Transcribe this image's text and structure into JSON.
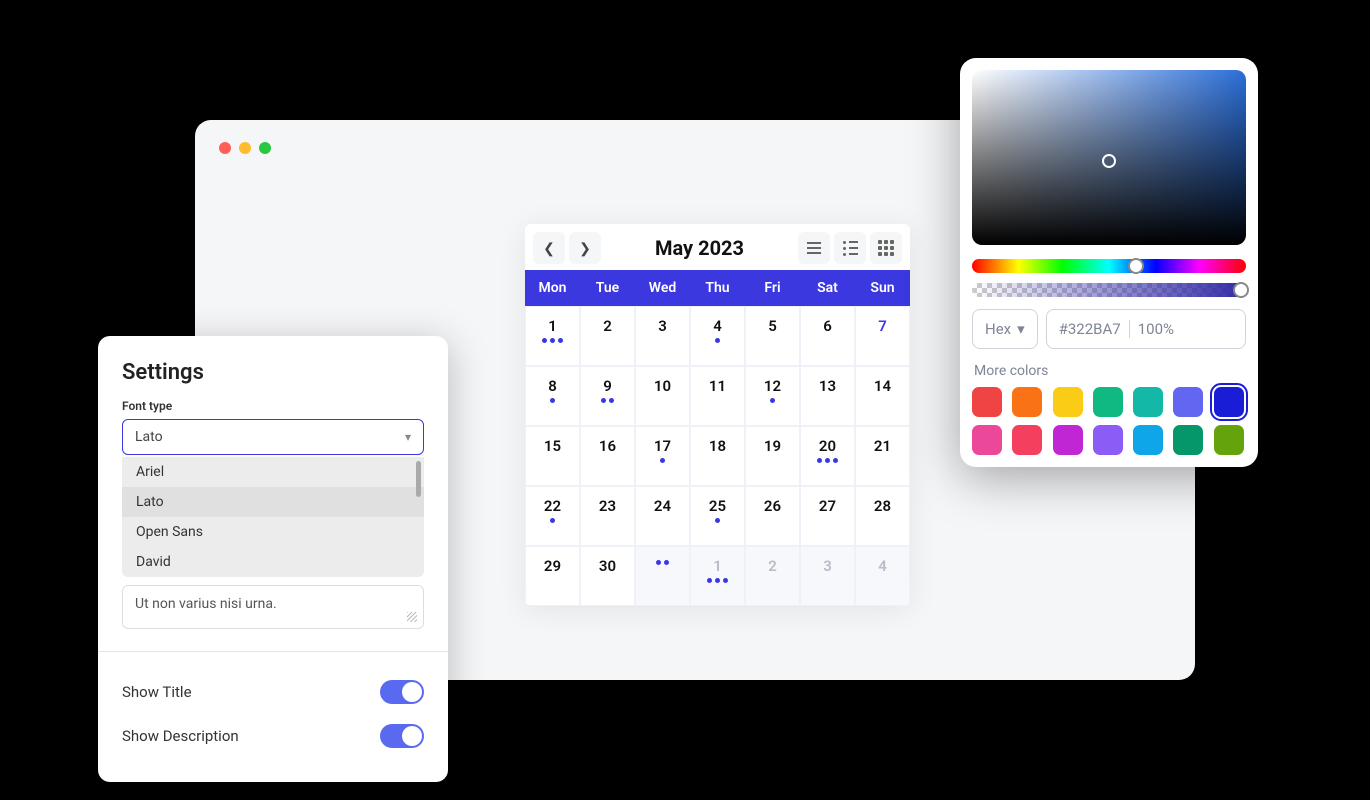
{
  "browser": {},
  "calendar": {
    "title": "May 2023",
    "daynames": [
      "Mon",
      "Tue",
      "Wed",
      "Thu",
      "Fri",
      "Sat",
      "Sun"
    ],
    "cells": [
      {
        "num": "1",
        "dots": 3,
        "out": false,
        "highlight": false
      },
      {
        "num": "2",
        "dots": 0,
        "out": false,
        "highlight": false
      },
      {
        "num": "3",
        "dots": 0,
        "out": false,
        "highlight": false
      },
      {
        "num": "4",
        "dots": 1,
        "out": false,
        "highlight": false
      },
      {
        "num": "5",
        "dots": 0,
        "out": false,
        "highlight": false
      },
      {
        "num": "6",
        "dots": 0,
        "out": false,
        "highlight": false
      },
      {
        "num": "7",
        "dots": 0,
        "out": false,
        "highlight": true
      },
      {
        "num": "8",
        "dots": 1,
        "out": false,
        "highlight": false
      },
      {
        "num": "9",
        "dots": 2,
        "out": false,
        "highlight": false
      },
      {
        "num": "10",
        "dots": 0,
        "out": false,
        "highlight": false
      },
      {
        "num": "11",
        "dots": 0,
        "out": false,
        "highlight": false
      },
      {
        "num": "12",
        "dots": 1,
        "out": false,
        "highlight": false
      },
      {
        "num": "13",
        "dots": 0,
        "out": false,
        "highlight": false
      },
      {
        "num": "14",
        "dots": 0,
        "out": false,
        "highlight": false
      },
      {
        "num": "15",
        "dots": 0,
        "out": false,
        "highlight": false
      },
      {
        "num": "16",
        "dots": 0,
        "out": false,
        "highlight": false
      },
      {
        "num": "17",
        "dots": 1,
        "out": false,
        "highlight": false
      },
      {
        "num": "18",
        "dots": 0,
        "out": false,
        "highlight": false
      },
      {
        "num": "19",
        "dots": 0,
        "out": false,
        "highlight": false
      },
      {
        "num": "20",
        "dots": 3,
        "out": false,
        "highlight": false
      },
      {
        "num": "21",
        "dots": 0,
        "out": false,
        "highlight": false
      },
      {
        "num": "22",
        "dots": 1,
        "out": false,
        "highlight": false
      },
      {
        "num": "23",
        "dots": 0,
        "out": false,
        "highlight": false
      },
      {
        "num": "24",
        "dots": 0,
        "out": false,
        "highlight": false
      },
      {
        "num": "25",
        "dots": 1,
        "out": false,
        "highlight": false
      },
      {
        "num": "26",
        "dots": 0,
        "out": false,
        "highlight": false
      },
      {
        "num": "27",
        "dots": 0,
        "out": false,
        "highlight": false
      },
      {
        "num": "28",
        "dots": 0,
        "out": false,
        "highlight": false
      },
      {
        "num": "29",
        "dots": 0,
        "out": false,
        "highlight": false
      },
      {
        "num": "30",
        "dots": 0,
        "out": false,
        "highlight": false
      },
      {
        "num": "",
        "dots": 2,
        "out": true,
        "highlight": false
      },
      {
        "num": "1",
        "dots": 3,
        "out": true,
        "highlight": false
      },
      {
        "num": "2",
        "dots": 0,
        "out": true,
        "highlight": false
      },
      {
        "num": "3",
        "dots": 0,
        "out": true,
        "highlight": false
      },
      {
        "num": "4",
        "dots": 0,
        "out": true,
        "highlight": false
      }
    ]
  },
  "settings": {
    "title": "Settings",
    "font_type_label": "Font type",
    "font_type_value": "Lato",
    "font_options": [
      "Ariel",
      "Lato",
      "Open Sans",
      "David"
    ],
    "font_selected_index": 1,
    "textarea_value": "Ut non varius nisi urna.",
    "show_title_label": "Show Title",
    "show_title_on": true,
    "show_description_label": "Show Description",
    "show_description_on": true
  },
  "color_picker": {
    "format_label": "Hex",
    "hex_value": "#322BA7",
    "opacity_value": "100%",
    "more_colors_label": "More colors",
    "hue_handle_pct": 60,
    "alpha_handle_pct": 98,
    "swatches": [
      {
        "color": "#f04444",
        "selected": false
      },
      {
        "color": "#f97316",
        "selected": false
      },
      {
        "color": "#facc15",
        "selected": false
      },
      {
        "color": "#10b981",
        "selected": false
      },
      {
        "color": "#14b8a6",
        "selected": false
      },
      {
        "color": "#6366f1",
        "selected": false
      },
      {
        "color": "#1a1dd6",
        "selected": true
      },
      {
        "color": "#ec4899",
        "selected": false
      },
      {
        "color": "#f43f5e",
        "selected": false
      },
      {
        "color": "#c026d3",
        "selected": false
      },
      {
        "color": "#8b5cf6",
        "selected": false
      },
      {
        "color": "#0ea5e9",
        "selected": false
      },
      {
        "color": "#059669",
        "selected": false
      },
      {
        "color": "#65a30d",
        "selected": false
      }
    ]
  }
}
